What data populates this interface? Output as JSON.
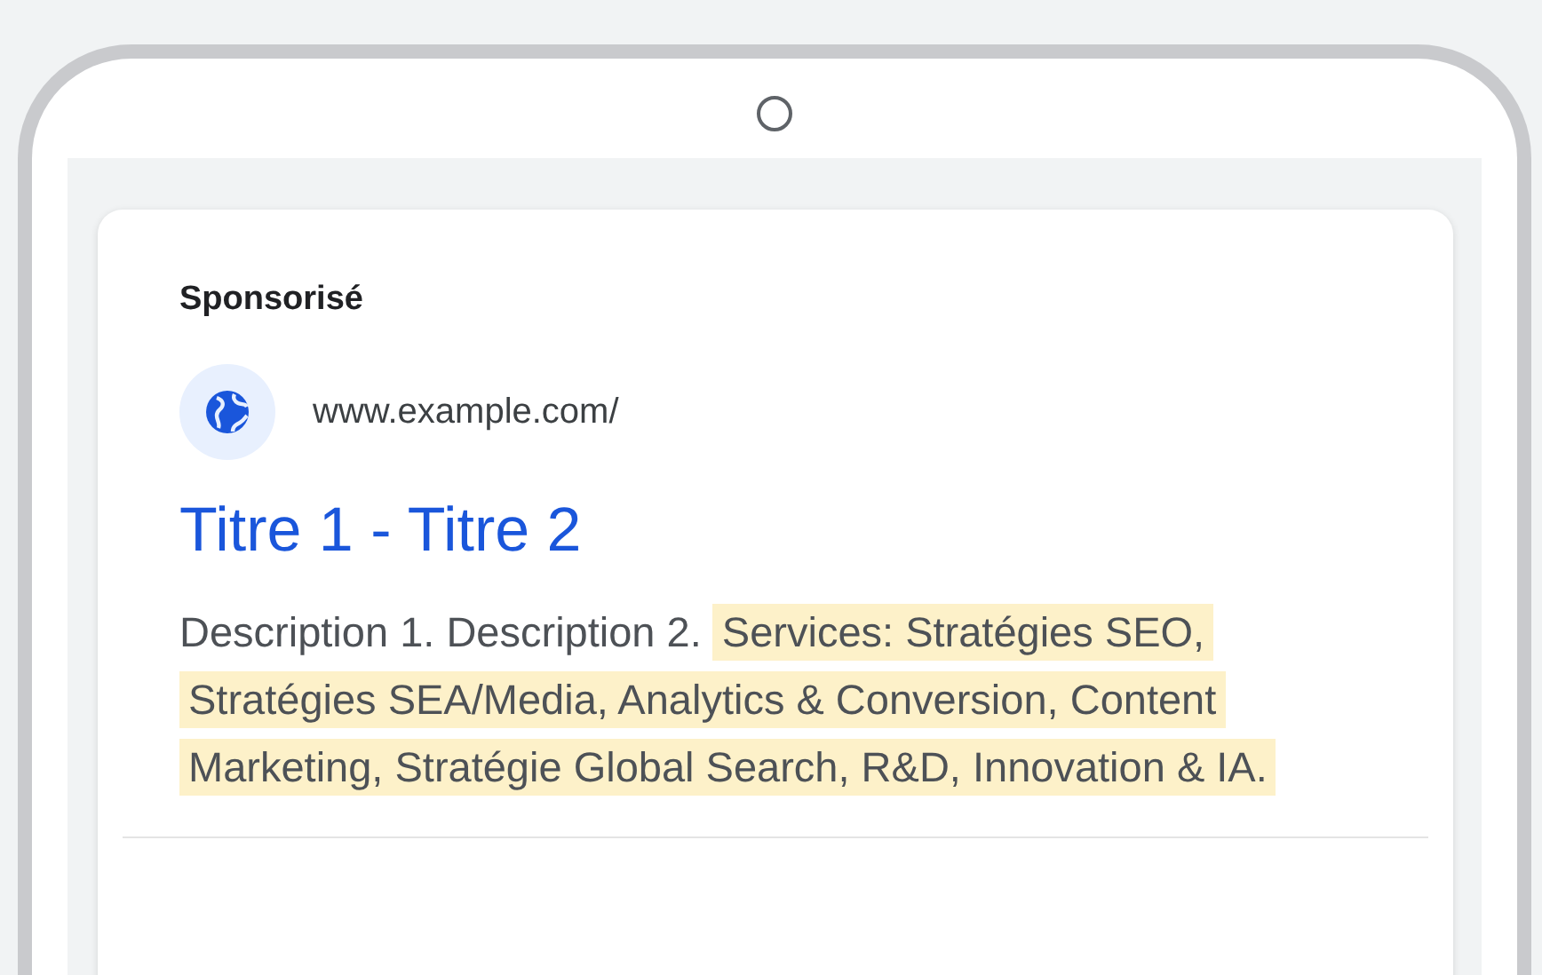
{
  "ad": {
    "label": "Sponsorisé",
    "url": "www.example.com/",
    "title": "Titre 1 - Titre 2",
    "description": [
      {
        "text": "Description 1. Description 2. ",
        "highlighted": false
      },
      {
        "text": "Services: Stratégies SEO, Stratégies SEA/Media, Analytics & Conversion, Content Marketing, Stratégie Global Search, R&D, Innovation & IA.",
        "highlighted": true
      }
    ]
  }
}
